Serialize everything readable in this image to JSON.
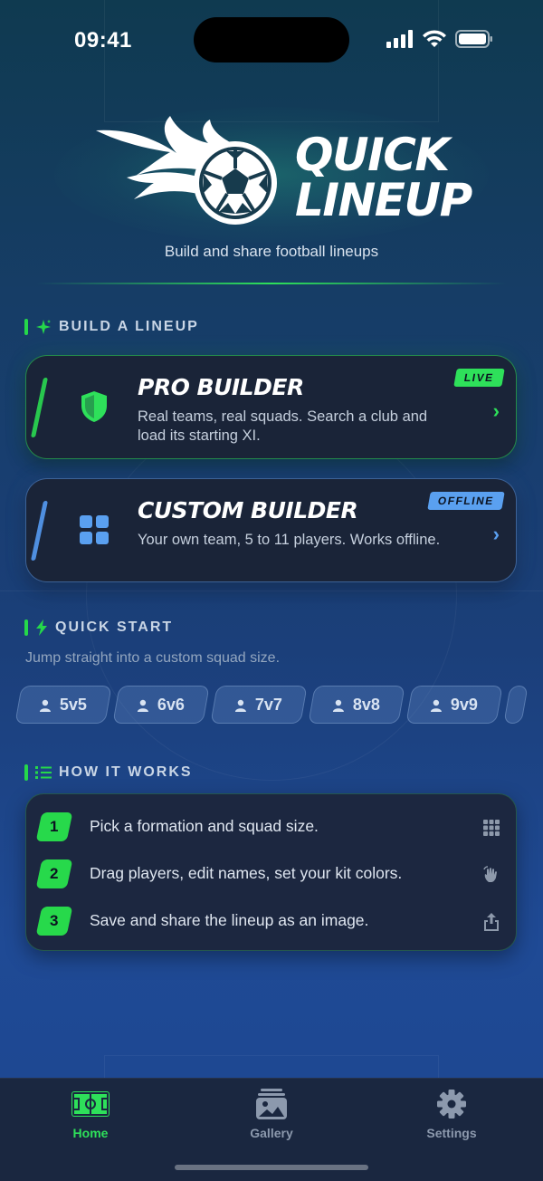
{
  "status_bar": {
    "time": "09:41"
  },
  "hero": {
    "logo_line1": "QUICK",
    "logo_line2": "LINEUP",
    "tagline": "Build and share football lineups"
  },
  "build_section": {
    "title": "BUILD A LINEUP",
    "cards": [
      {
        "title": "PRO BUILDER",
        "description": "Real teams, real squads. Search a club and load its starting XI.",
        "badge": "LIVE",
        "icon": "shield-icon",
        "accent": "#2ee05a"
      },
      {
        "title": "CUSTOM BUILDER",
        "description": "Your own team, 5 to 11 players. Works offline.",
        "badge": "OFFLINE",
        "icon": "grid-icon",
        "accent": "#5aa0f0"
      }
    ]
  },
  "quick_start": {
    "title": "QUICK START",
    "hint": "Jump straight into a custom squad size.",
    "sizes": [
      "5v5",
      "6v6",
      "7v7",
      "8v8",
      "9v9"
    ]
  },
  "how_it_works": {
    "title": "HOW IT WORKS",
    "steps": [
      {
        "number": "1",
        "text": "Pick a formation and squad size.",
        "icon": "grid-icon"
      },
      {
        "number": "2",
        "text": "Drag players, edit names, set your kit colors.",
        "icon": "drag-hand-icon"
      },
      {
        "number": "3",
        "text": "Save and share the lineup as an image.",
        "icon": "share-icon"
      }
    ]
  },
  "tab_bar": {
    "tabs": [
      {
        "label": "Home",
        "icon": "pitch-icon",
        "active": true
      },
      {
        "label": "Gallery",
        "icon": "gallery-icon",
        "active": false
      },
      {
        "label": "Settings",
        "icon": "gear-icon",
        "active": false
      }
    ],
    "active_color": "#2ee05a",
    "inactive_color": "#8c99ad"
  }
}
